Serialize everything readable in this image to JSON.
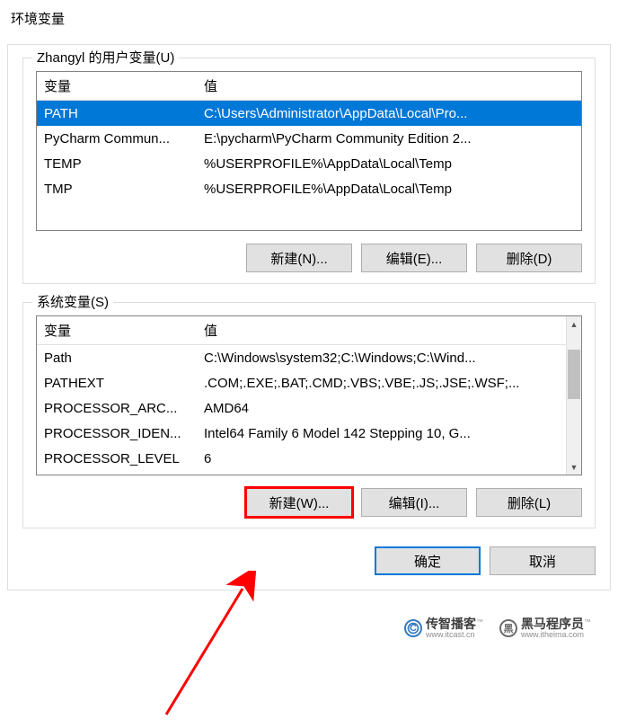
{
  "title": "环境变量",
  "userVars": {
    "label": "Zhangyl 的用户变量(U)",
    "header_var": "变量",
    "header_val": "值",
    "rows": [
      {
        "var": "PATH",
        "val": "C:\\Users\\Administrator\\AppData\\Local\\Pro..."
      },
      {
        "var": "PyCharm Commun...",
        "val": "E:\\pycharm\\PyCharm Community Edition 2..."
      },
      {
        "var": "TEMP",
        "val": "%USERPROFILE%\\AppData\\Local\\Temp"
      },
      {
        "var": "TMP",
        "val": "%USERPROFILE%\\AppData\\Local\\Temp"
      }
    ],
    "btn_new": "新建(N)...",
    "btn_edit": "编辑(E)...",
    "btn_del": "删除(D)"
  },
  "sysVars": {
    "label": "系统变量(S)",
    "header_var": "变量",
    "header_val": "值",
    "rows": [
      {
        "var": "Path",
        "val": "C:\\Windows\\system32;C:\\Windows;C:\\Wind..."
      },
      {
        "var": "PATHEXT",
        "val": ".COM;.EXE;.BAT;.CMD;.VBS;.VBE;.JS;.JSE;.WSF;..."
      },
      {
        "var": "PROCESSOR_ARC...",
        "val": "AMD64"
      },
      {
        "var": "PROCESSOR_IDEN...",
        "val": "Intel64 Family 6 Model 142 Stepping 10, G..."
      },
      {
        "var": "PROCESSOR_LEVEL",
        "val": "6"
      }
    ],
    "btn_new": "新建(W)...",
    "btn_edit": "编辑(I)...",
    "btn_del": "删除(L)"
  },
  "btn_ok": "确定",
  "btn_cancel": "取消",
  "watermark1": {
    "cn": "传智播客",
    "url": "www.itcast.cn"
  },
  "watermark2": {
    "cn": "黑马程序员",
    "url": "www.itheima.com"
  }
}
